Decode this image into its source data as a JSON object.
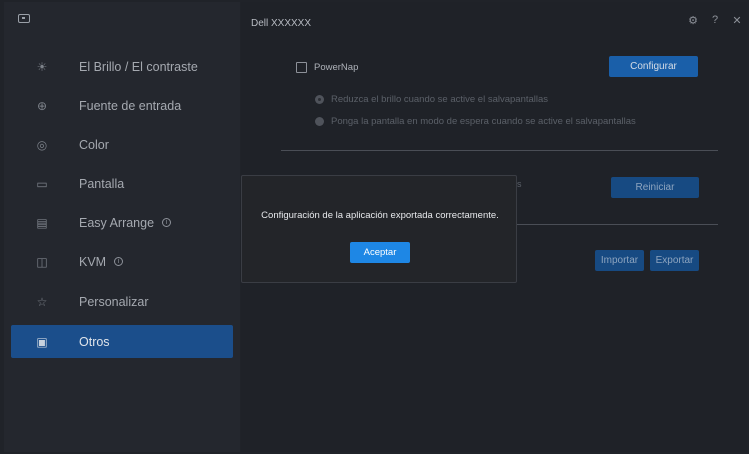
{
  "window": {
    "title": "Dell XXXXXX"
  },
  "sidebar": {
    "items": [
      {
        "label": "El Brillo / El contraste",
        "icon": "brightness-icon",
        "info": false,
        "active": false
      },
      {
        "label": "Fuente de entrada",
        "icon": "input-source-icon",
        "info": false,
        "active": false
      },
      {
        "label": "Color",
        "icon": "color-palette-icon",
        "info": false,
        "active": false
      },
      {
        "label": "Pantalla",
        "icon": "monitor-icon",
        "info": false,
        "active": false
      },
      {
        "label": "Easy Arrange",
        "icon": "easy-arrange-icon",
        "info": true,
        "active": false
      },
      {
        "label": "KVM",
        "icon": "kvm-icon",
        "info": true,
        "active": false
      },
      {
        "label": "Personalizar",
        "icon": "star-icon",
        "info": false,
        "active": false
      },
      {
        "label": "Otros",
        "icon": "others-icon",
        "info": false,
        "active": true
      }
    ]
  },
  "main": {
    "powernap": {
      "checkbox_label": "PowerNap",
      "checked": false,
      "configure_button": "Configurar",
      "options": [
        {
          "label": "Reduzca el brillo cuando se active el salvapantallas",
          "selected": true
        },
        {
          "label": "Ponga la pantalla en modo de espera cuando se active el salvapantallas",
          "selected": false
        }
      ]
    },
    "reset": {
      "label_fragment": "s",
      "button": "Reiniciar"
    },
    "config": {
      "import_button": "Importar",
      "export_button": "Exportar"
    }
  },
  "modal": {
    "message": "Configuración de la aplicación exportada correctamente.",
    "ok_button": "Aceptar"
  },
  "colors": {
    "accent": "#1e87e5",
    "active_nav": "#1b4e8b",
    "sidebar_bg": "#24272e",
    "main_bg": "#1f2228",
    "modal_bg": "#232529"
  }
}
